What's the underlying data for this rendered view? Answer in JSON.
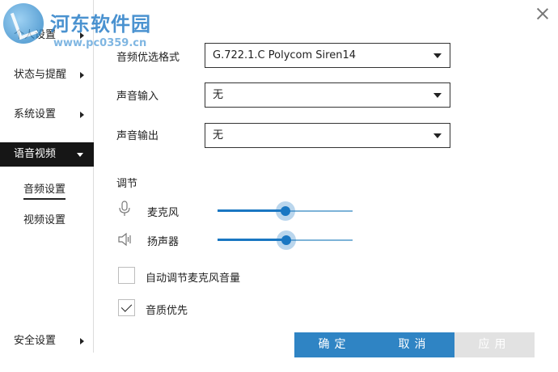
{
  "watermark": {
    "title": "河东软件园",
    "url": "www.pc0359.cn"
  },
  "sidebar": {
    "items": [
      {
        "label": "个人设置"
      },
      {
        "label": "状态与提醒"
      },
      {
        "label": "系统设置"
      },
      {
        "label": "语音视频",
        "active": true
      },
      {
        "label": "安全设置"
      }
    ],
    "sub_items": [
      {
        "label": "音频设置",
        "selected": true
      },
      {
        "label": "视频设置"
      }
    ]
  },
  "audio": {
    "codec": {
      "label": "音频优选格式",
      "value": "G.722.1.C Polycom Siren14"
    },
    "input": {
      "label": "声音输入",
      "value": "无"
    },
    "output": {
      "label": "声音输出",
      "value": "无"
    },
    "adjust_title": "调节",
    "mic": {
      "label": "麦克风",
      "level": 0.5,
      "icon": "microphone-icon"
    },
    "speaker": {
      "label": "扬声器",
      "level": 0.51,
      "icon": "speaker-icon"
    },
    "auto_adjust": {
      "label": "自动调节麦克风音量",
      "checked": false
    },
    "quality_first": {
      "label": "音质优先",
      "checked": true
    }
  },
  "buttons": {
    "ok": "确定",
    "cancel": "取消",
    "apply": "应用"
  },
  "colors": {
    "accent": "#2f84c4",
    "slider": "#1a77c2",
    "disabled": "#e2e2e2",
    "nav_active": "#161616"
  }
}
